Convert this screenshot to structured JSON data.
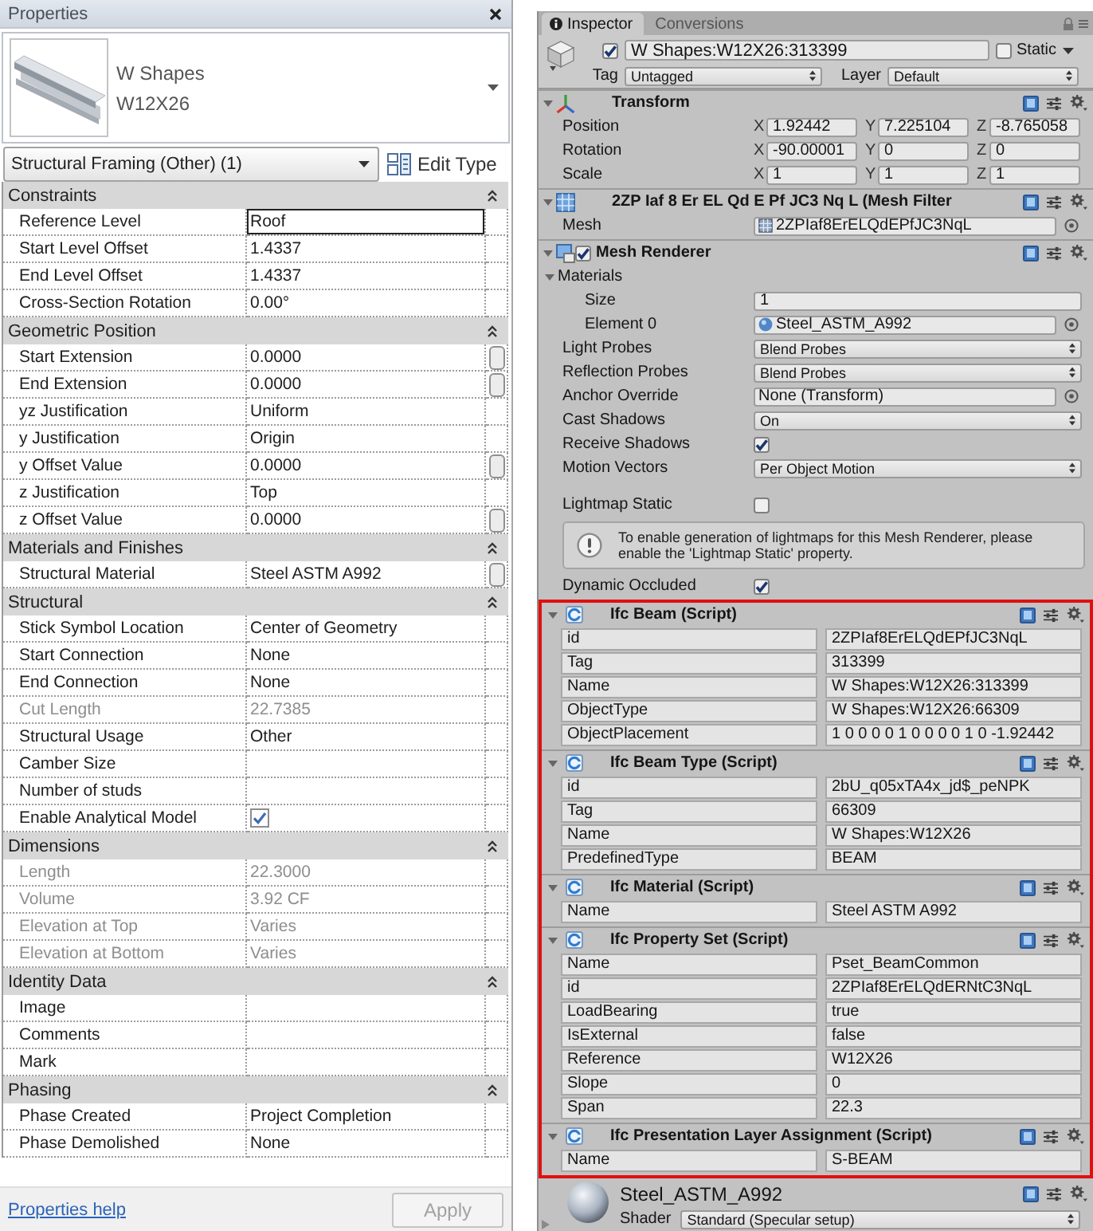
{
  "properties_panel": {
    "title": "Properties",
    "type_selector": {
      "family": "W Shapes",
      "type": "W12X26"
    },
    "category_dropdown": "Structural Framing (Other) (1)",
    "edit_type_button": "Edit Type",
    "groups": [
      {
        "name": "Constraints",
        "expanded": true,
        "rows": [
          {
            "kind": "text",
            "label": "Reference Level",
            "value": "Roof",
            "disabled": false,
            "focused": true,
            "link_button": false
          },
          {
            "kind": "text",
            "label": "Start Level Offset",
            "value": "1.4337",
            "disabled": false,
            "focused": false,
            "link_button": false
          },
          {
            "kind": "text",
            "label": "End Level Offset",
            "value": "1.4337",
            "disabled": false,
            "focused": false,
            "link_button": false
          },
          {
            "kind": "text",
            "label": "Cross-Section Rotation",
            "value": "0.00°",
            "disabled": false,
            "focused": false,
            "link_button": false
          }
        ]
      },
      {
        "name": "Geometric Position",
        "expanded": true,
        "rows": [
          {
            "kind": "text",
            "label": "Start Extension",
            "value": "0.0000",
            "disabled": false,
            "focused": false,
            "link_button": true
          },
          {
            "kind": "text",
            "label": "End Extension",
            "value": "0.0000",
            "disabled": false,
            "focused": false,
            "link_button": true
          },
          {
            "kind": "text",
            "label": "yz Justification",
            "value": "Uniform",
            "disabled": false,
            "focused": false,
            "link_button": false
          },
          {
            "kind": "text",
            "label": "y Justification",
            "value": "Origin",
            "disabled": false,
            "focused": false,
            "link_button": false
          },
          {
            "kind": "text",
            "label": "y Offset Value",
            "value": "0.0000",
            "disabled": false,
            "focused": false,
            "link_button": true
          },
          {
            "kind": "text",
            "label": "z Justification",
            "value": "Top",
            "disabled": false,
            "focused": false,
            "link_button": false
          },
          {
            "kind": "text",
            "label": "z Offset Value",
            "value": "0.0000",
            "disabled": false,
            "focused": false,
            "link_button": true
          }
        ]
      },
      {
        "name": "Materials and Finishes",
        "expanded": true,
        "rows": [
          {
            "kind": "text",
            "label": "Structural Material",
            "value": "Steel ASTM A992",
            "disabled": false,
            "focused": false,
            "link_button": true
          }
        ]
      },
      {
        "name": "Structural",
        "expanded": true,
        "rows": [
          {
            "kind": "text",
            "label": "Stick Symbol Location",
            "value": "Center of Geometry",
            "disabled": false,
            "focused": false,
            "link_button": false
          },
          {
            "kind": "text",
            "label": "Start Connection",
            "value": "None",
            "disabled": false,
            "focused": false,
            "link_button": false
          },
          {
            "kind": "text",
            "label": "End Connection",
            "value": "None",
            "disabled": false,
            "focused": false,
            "link_button": false
          },
          {
            "kind": "text",
            "label": "Cut Length",
            "value": "22.7385",
            "disabled": true,
            "focused": false,
            "link_button": false
          },
          {
            "kind": "text",
            "label": "Structural Usage",
            "value": "Other",
            "disabled": false,
            "focused": false,
            "link_button": false
          },
          {
            "kind": "text",
            "label": "Camber Size",
            "disabled": false,
            "focused": false,
            "link_button": false
          },
          {
            "kind": "text",
            "label": "Number of studs",
            "disabled": false,
            "focused": false,
            "link_button": false
          },
          {
            "kind": "checkbox",
            "label": "Enable Analytical Model",
            "checked": true,
            "disabled": false,
            "focused": false,
            "link_button": false
          }
        ]
      },
      {
        "name": "Dimensions",
        "expanded": true,
        "rows": [
          {
            "kind": "text",
            "label": "Length",
            "value": "22.3000",
            "disabled": true,
            "focused": false,
            "link_button": false
          },
          {
            "kind": "text",
            "label": "Volume",
            "value": "3.92 CF",
            "disabled": true,
            "focused": false,
            "link_button": false
          },
          {
            "kind": "text",
            "label": "Elevation at Top",
            "value": "Varies",
            "disabled": true,
            "focused": false,
            "link_button": false
          },
          {
            "kind": "text",
            "label": "Elevation at Bottom",
            "value": "Varies",
            "disabled": true,
            "focused": false,
            "link_button": false
          }
        ]
      },
      {
        "name": "Identity Data",
        "expanded": true,
        "rows": [
          {
            "kind": "text",
            "label": "Image",
            "disabled": false,
            "focused": false,
            "link_button": false
          },
          {
            "kind": "text",
            "label": "Comments",
            "disabled": false,
            "focused": false,
            "link_button": false
          },
          {
            "kind": "text",
            "label": "Mark",
            "disabled": false,
            "focused": false,
            "link_button": false
          }
        ]
      },
      {
        "name": "Phasing",
        "expanded": true,
        "rows": [
          {
            "kind": "text",
            "label": "Phase Created",
            "value": "Project Completion",
            "disabled": false,
            "focused": false,
            "link_button": false
          },
          {
            "kind": "text",
            "label": "Phase Demolished",
            "value": "None",
            "disabled": false,
            "focused": false,
            "link_button": false
          }
        ]
      }
    ],
    "help_link": "Properties help",
    "apply_button": {
      "label": "Apply",
      "disabled": true
    }
  },
  "inspector": {
    "tabs": [
      {
        "label": "Inspector",
        "selected": true
      },
      {
        "label": "Conversions",
        "selected": false
      }
    ],
    "object": {
      "active": true,
      "name": "W Shapes:W12X26:313399",
      "static": false,
      "static_label": "Static",
      "tag_label": "Tag",
      "tag": "Untagged",
      "layer_label": "Layer",
      "layer": "Default"
    },
    "components": [
      {
        "kind": "transform",
        "title": "Transform",
        "expanded": true,
        "rows": [
          {
            "label": "Position",
            "fields": [
              {
                "axis": "X",
                "value": "1.92442"
              },
              {
                "axis": "Y",
                "value": "7.225104"
              },
              {
                "axis": "Z",
                "value": "-8.765058"
              }
            ]
          },
          {
            "label": "Rotation",
            "fields": [
              {
                "axis": "X",
                "value": "-90.00001"
              },
              {
                "axis": "Y",
                "value": "0"
              },
              {
                "axis": "Z",
                "value": "0"
              }
            ]
          },
          {
            "label": "Scale",
            "fields": [
              {
                "axis": "X",
                "value": "1"
              },
              {
                "axis": "Y",
                "value": "1"
              },
              {
                "axis": "Z",
                "value": "1"
              }
            ]
          }
        ]
      },
      {
        "kind": "mesh_filter",
        "title": "2ZP Iaf 8 Er EL Qd E Pf JC3 Nq L (Mesh Filter",
        "expanded": true,
        "rows": [
          {
            "kind": "mesh",
            "label": "Mesh",
            "value": "2ZPIaf8ErELQdEPfJC3NqL"
          }
        ]
      },
      {
        "kind": "mesh_renderer",
        "title": "Mesh Renderer",
        "expanded": true,
        "enabled": true,
        "rows": [
          {
            "kind": "foldout",
            "label": "Materials",
            "expanded": true,
            "children": [
              {
                "kind": "number",
                "label": "Size",
                "value": "1"
              },
              {
                "kind": "material",
                "label": "Element 0",
                "value": "Steel_ASTM_A992"
              }
            ]
          },
          {
            "kind": "dropdown",
            "label": "Light Probes",
            "value": "Blend Probes"
          },
          {
            "kind": "dropdown",
            "label": "Reflection Probes",
            "value": "Blend Probes"
          },
          {
            "kind": "object",
            "label": "Anchor Override",
            "value": "None (Transform)"
          },
          {
            "kind": "dropdown",
            "label": "Cast Shadows",
            "value": "On"
          },
          {
            "kind": "checkbox",
            "label": "Receive Shadows",
            "checked": true
          },
          {
            "kind": "dropdown",
            "label": "Motion Vectors",
            "value": "Per Object Motion"
          }
        ],
        "lightmap_rows": [
          {
            "kind": "checkbox",
            "label": "Lightmap Static",
            "checked": false
          },
          {
            "kind": "info",
            "text": "To enable generation of lightmaps for this Mesh Renderer, please enable the 'Lightmap Static' property."
          },
          {
            "kind": "checkbox",
            "label": "Dynamic Occluded",
            "checked": true
          }
        ]
      }
    ],
    "highlighted_scripts": [
      {
        "title": "Ifc Beam (Script)",
        "expanded": true,
        "fields": [
          {
            "label": "id",
            "value": "2ZPIaf8ErELQdEPfJC3NqL"
          },
          {
            "label": "Tag",
            "value": "313399"
          },
          {
            "label": "Name",
            "value": "W Shapes:W12X26:313399"
          },
          {
            "label": "ObjectType",
            "value": "W Shapes:W12X26:66309"
          },
          {
            "label": "ObjectPlacement",
            "value": "1 0 0 0 0 1 0 0 0 0 1 0 -1.92442"
          }
        ]
      },
      {
        "title": "Ifc Beam Type (Script)",
        "expanded": true,
        "fields": [
          {
            "label": "id",
            "value": "2bU_q05xTA4x_jd$_peNPK"
          },
          {
            "label": "Tag",
            "value": "66309"
          },
          {
            "label": "Name",
            "value": "W Shapes:W12X26"
          },
          {
            "label": "PredefinedType",
            "value": "BEAM"
          }
        ]
      },
      {
        "title": "Ifc Material (Script)",
        "expanded": true,
        "fields": [
          {
            "label": "Name",
            "value": "Steel ASTM A992"
          }
        ]
      },
      {
        "title": "Ifc Property Set (Script)",
        "expanded": true,
        "fields": [
          {
            "label": "Name",
            "value": "Pset_BeamCommon"
          },
          {
            "label": "id",
            "value": "2ZPIaf8ErELQdERNtC3NqL"
          },
          {
            "label": "LoadBearing",
            "value": "true"
          },
          {
            "label": "IsExternal",
            "value": "false"
          },
          {
            "label": "Reference",
            "value": "W12X26"
          },
          {
            "label": "Slope",
            "value": "0"
          },
          {
            "label": "Span",
            "value": "22.3"
          }
        ]
      },
      {
        "title": "Ifc Presentation Layer Assignment (Script)",
        "expanded": true,
        "fields": [
          {
            "label": "Name",
            "value": "S-BEAM"
          }
        ]
      }
    ],
    "material_preview": {
      "name": "Steel_ASTM_A992",
      "shader_label": "Shader",
      "shader": "Standard (Specular setup)"
    }
  }
}
